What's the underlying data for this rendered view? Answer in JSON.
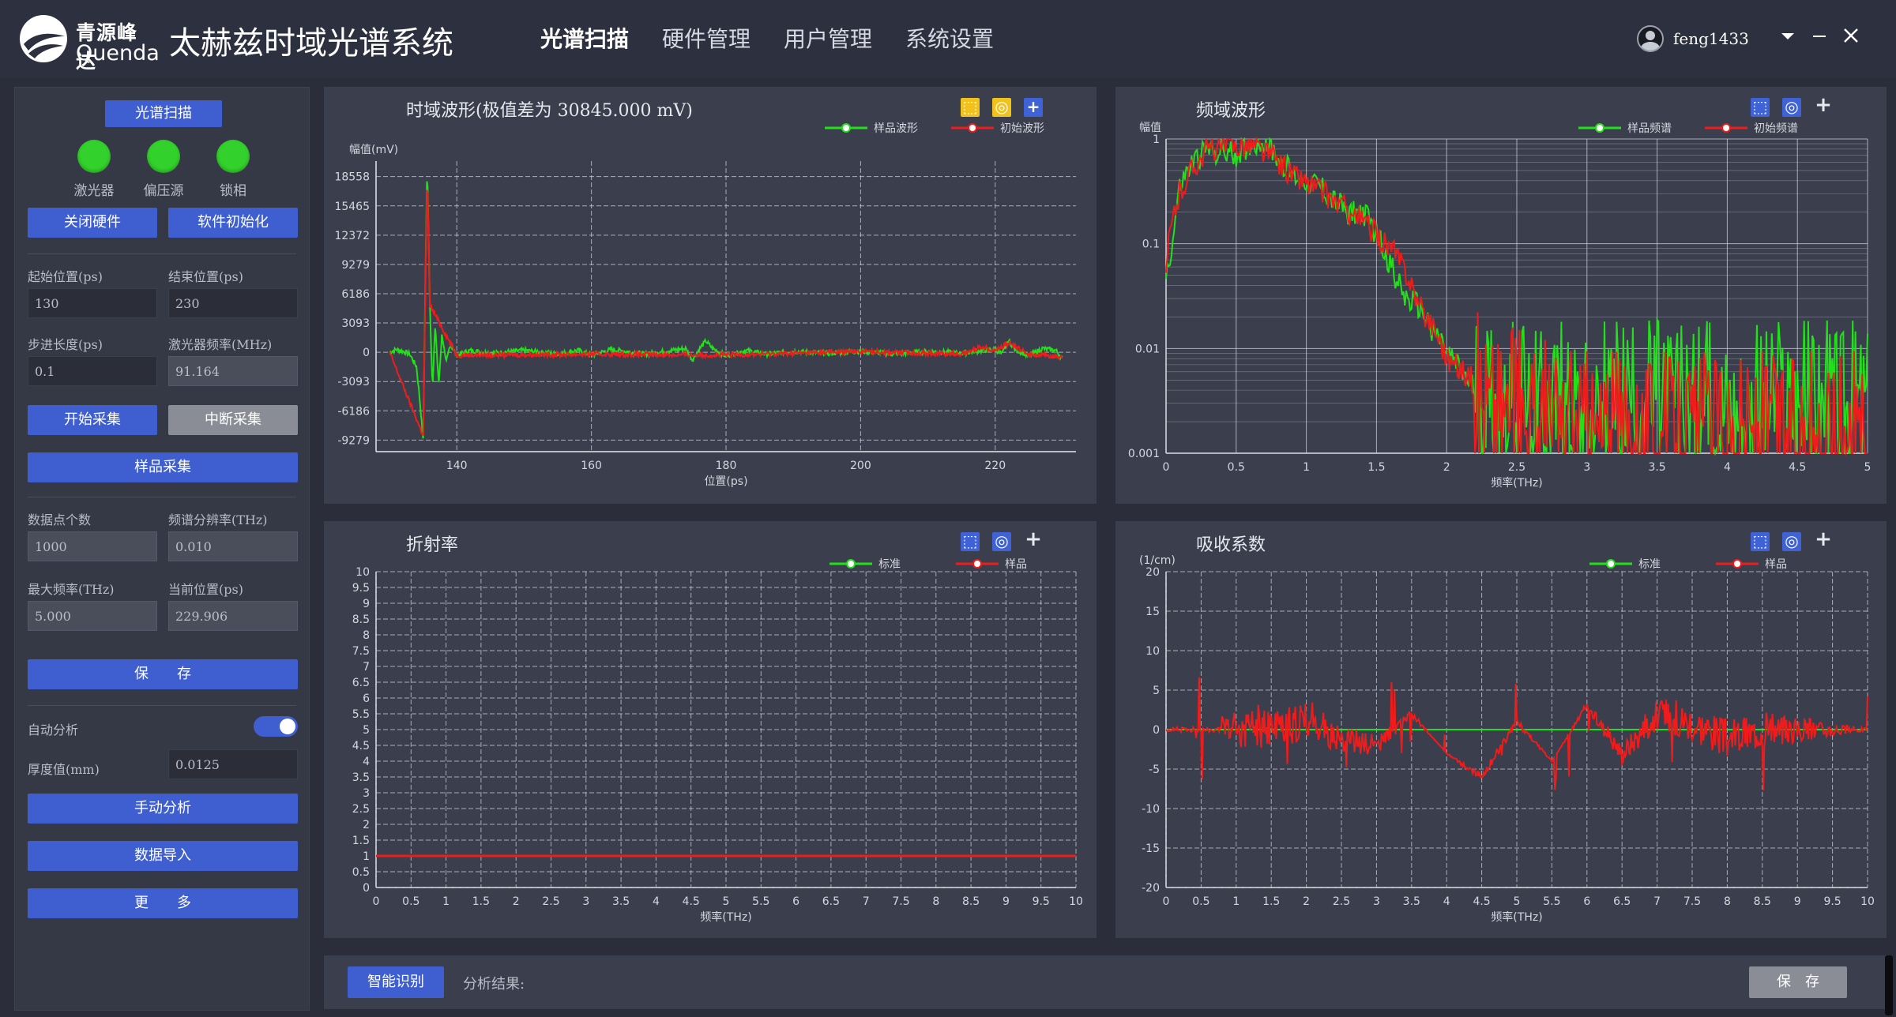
{
  "app": {
    "logo_cn": "青源峰达",
    "logo_en": "Quenda",
    "title": "太赫兹时域光谱系统",
    "user": "feng1433"
  },
  "nav": [
    "光谱扫描",
    "硬件管理",
    "用户管理",
    "系统设置"
  ],
  "left": {
    "scan_button": "光谱扫描",
    "indicators": [
      {
        "label": "激光器",
        "color": "#33d12c"
      },
      {
        "label": "偏压源",
        "color": "#33d12c"
      },
      {
        "label": "锁相",
        "color": "#33d12c"
      }
    ],
    "close_hw": "关闭硬件",
    "soft_init": "软件初始化",
    "start_pos_label": "起始位置(ps)",
    "start_pos": "130",
    "end_pos_label": "结束位置(ps)",
    "end_pos": "230",
    "step_label": "步进长度(ps)",
    "step": "0.1",
    "laser_freq_label": "激光器频率(MHz)",
    "laser_freq": "91.164",
    "start_acq": "开始采集",
    "stop_acq": "中断采集",
    "sample_acq": "样品采集",
    "points_label": "数据点个数",
    "points": "1000",
    "freq_res_label": "频谱分辨率(THz)",
    "freq_res": "0.010",
    "max_freq_label": "最大频率(THz)",
    "max_freq": "5.000",
    "cur_pos_label": "当前位置(ps)",
    "cur_pos": "229.906",
    "save": "保　　存",
    "auto_analysis": "自动分析",
    "auto_analysis_on": true,
    "thickness_label": "厚度值(mm)",
    "thickness": "0.0125",
    "manual_analysis": "手动分析",
    "data_import": "数据导入",
    "more": "更　　多"
  },
  "bottom": {
    "smart_id": "智能识别",
    "analysis_result": "分析结果:",
    "save": "保　存"
  },
  "colors": {
    "green": "#22e01a",
    "red": "#f01c1c",
    "accent": "#3f5fd1"
  },
  "chart_data": [
    {
      "type": "line",
      "title": "时域波形(极值差为 30845.000 mV)",
      "ylabel": "幅值(mV)",
      "xlabel": "位置(ps)",
      "xlim": [
        128,
        232
      ],
      "ylim": [
        -10500,
        20200
      ],
      "xticks": [
        140,
        160,
        180,
        200,
        220
      ],
      "yticks": [
        18558,
        15465,
        12372,
        9279,
        6186,
        3093,
        0,
        -3093,
        -6186,
        -9279
      ],
      "grid": true,
      "legend": "top-right",
      "series": [
        {
          "name": "样品波形",
          "color": "#22e01a",
          "x": [
            130,
            131,
            132,
            133,
            134,
            134.5,
            135,
            135.3,
            135.6,
            136,
            136.4,
            136.8,
            137.3,
            137.8,
            138.4,
            139,
            140,
            142,
            145,
            150,
            155,
            158,
            160,
            163,
            168,
            172,
            174,
            175,
            176,
            177,
            178,
            180,
            183,
            186,
            190,
            195,
            200,
            205,
            210,
            215,
            218,
            220,
            221,
            222,
            223,
            225,
            227,
            229,
            230
          ],
          "values": [
            0,
            300,
            100,
            -200,
            -1500,
            -5000,
            -9300,
            6000,
            20000,
            5000,
            -4000,
            3000,
            -3500,
            2000,
            -1200,
            800,
            -300,
            200,
            -100,
            200,
            -200,
            200,
            -300,
            300,
            -200,
            200,
            400,
            -800,
            300,
            1200,
            400,
            -400,
            200,
            -200,
            100,
            -100,
            100,
            -200,
            100,
            -100,
            200,
            300,
            -200,
            1200,
            300,
            -400,
            400,
            200,
            -700
          ]
        },
        {
          "name": "初始波形",
          "color": "#f01c1c",
          "x": [
            130,
            135,
            135.6,
            136,
            140,
            160,
            180,
            200,
            215,
            218,
            220,
            222,
            225,
            230
          ],
          "values": [
            0,
            -8800,
            19000,
            5000,
            -300,
            -200,
            -300,
            100,
            -200,
            600,
            200,
            1000,
            -200,
            -500
          ]
        }
      ]
    },
    {
      "type": "line",
      "title": "频域波形",
      "ylabel": "幅值",
      "xlabel": "频率(THz)",
      "xlim": [
        0,
        5
      ],
      "ylim": [
        0.001,
        1
      ],
      "yscale": "log",
      "xticks": [
        0,
        0.5,
        1,
        1.5,
        2,
        2.5,
        3,
        3.5,
        4,
        4.5,
        5
      ],
      "yticks": [
        1,
        0.1,
        0.01,
        0.001
      ],
      "grid": true,
      "legend": "top-right",
      "series": [
        {
          "name": "样品频谱",
          "color": "#22e01a",
          "x": [
            0,
            0.05,
            0.1,
            0.2,
            0.3,
            0.4,
            0.5,
            0.6,
            0.7,
            0.8,
            0.9,
            1.0,
            1.1,
            1.2,
            1.3,
            1.4,
            1.5,
            1.6,
            1.7,
            1.8,
            1.9,
            2.0,
            2.1,
            2.2,
            2.3,
            2.5,
            3.0,
            3.5,
            4.0,
            4.5,
            5.0
          ],
          "values": [
            0.05,
            0.1,
            0.35,
            0.6,
            0.8,
            0.75,
            0.7,
            0.9,
            0.95,
            0.65,
            0.45,
            0.4,
            0.35,
            0.25,
            0.2,
            0.2,
            0.12,
            0.06,
            0.03,
            0.025,
            0.015,
            0.009,
            0.006,
            0.004,
            0.003,
            0.003,
            0.003,
            0.003,
            0.003,
            0.003,
            0.003
          ]
        },
        {
          "name": "初始频谱",
          "color": "#f01c1c",
          "x": [
            0,
            0.1,
            0.3,
            0.6,
            0.9,
            1.2,
            1.5,
            1.8,
            2.0,
            2.3,
            2.7,
            3.0,
            3.5,
            4.0,
            4.5,
            5.0
          ],
          "values": [
            0.05,
            0.3,
            0.8,
            0.9,
            0.45,
            0.25,
            0.12,
            0.025,
            0.008,
            0.003,
            0.002,
            0.0015,
            0.0015,
            0.0015,
            0.0015,
            0.0015
          ]
        }
      ]
    },
    {
      "type": "line",
      "title": "折射率",
      "xlabel": "频率(THz)",
      "xlim": [
        0,
        10
      ],
      "ylim": [
        0,
        10
      ],
      "xticks": [
        0,
        0.5,
        1,
        1.5,
        2,
        2.5,
        3,
        3.5,
        4,
        4.5,
        5,
        5.5,
        6,
        6.5,
        7,
        7.5,
        8,
        8.5,
        9,
        9.5,
        10
      ],
      "yticks": [
        10,
        9.5,
        9,
        8.5,
        8,
        7.5,
        7,
        6.5,
        6,
        5.5,
        5,
        4.5,
        4,
        3.5,
        3,
        2.5,
        2,
        1.5,
        1,
        0.5,
        0
      ],
      "grid": true,
      "legend": "top-right",
      "series": [
        {
          "name": "标准",
          "color": "#22e01a",
          "x": [
            0,
            10
          ],
          "values": [
            1,
            1
          ]
        },
        {
          "name": "样品",
          "color": "#f01c1c",
          "x": [
            0,
            10
          ],
          "values": [
            1,
            1
          ]
        }
      ]
    },
    {
      "type": "line",
      "title": "吸收系数",
      "ylabel": "(1/cm)",
      "xlabel": "频率(THz)",
      "xlim": [
        0,
        10
      ],
      "ylim": [
        -20,
        20
      ],
      "xticks": [
        0,
        0.5,
        1,
        1.5,
        2,
        2.5,
        3,
        3.5,
        4,
        4.5,
        5,
        5.5,
        6,
        6.5,
        7,
        7.5,
        8,
        8.5,
        9,
        9.5,
        10
      ],
      "yticks": [
        20,
        15,
        10,
        5,
        0,
        -5,
        -10,
        -15,
        -20
      ],
      "grid": true,
      "legend": "top-right",
      "series": [
        {
          "name": "标准",
          "color": "#22e01a",
          "x": [
            0,
            10
          ],
          "values": [
            0,
            0
          ]
        },
        {
          "name": "样品",
          "color": "#f01c1c",
          "x": [
            0,
            0.5,
            1,
            1.5,
            2,
            2.5,
            3,
            3.5,
            4,
            4.5,
            5,
            5.5,
            6,
            6.5,
            7,
            7.5,
            8,
            8.5,
            9,
            9.5,
            10
          ],
          "values": [
            0,
            0,
            0,
            0,
            1,
            -1,
            -2,
            2,
            -3,
            -6,
            1,
            -4,
            3,
            -3,
            2,
            1,
            -1,
            0,
            0,
            0,
            0
          ]
        }
      ]
    }
  ]
}
